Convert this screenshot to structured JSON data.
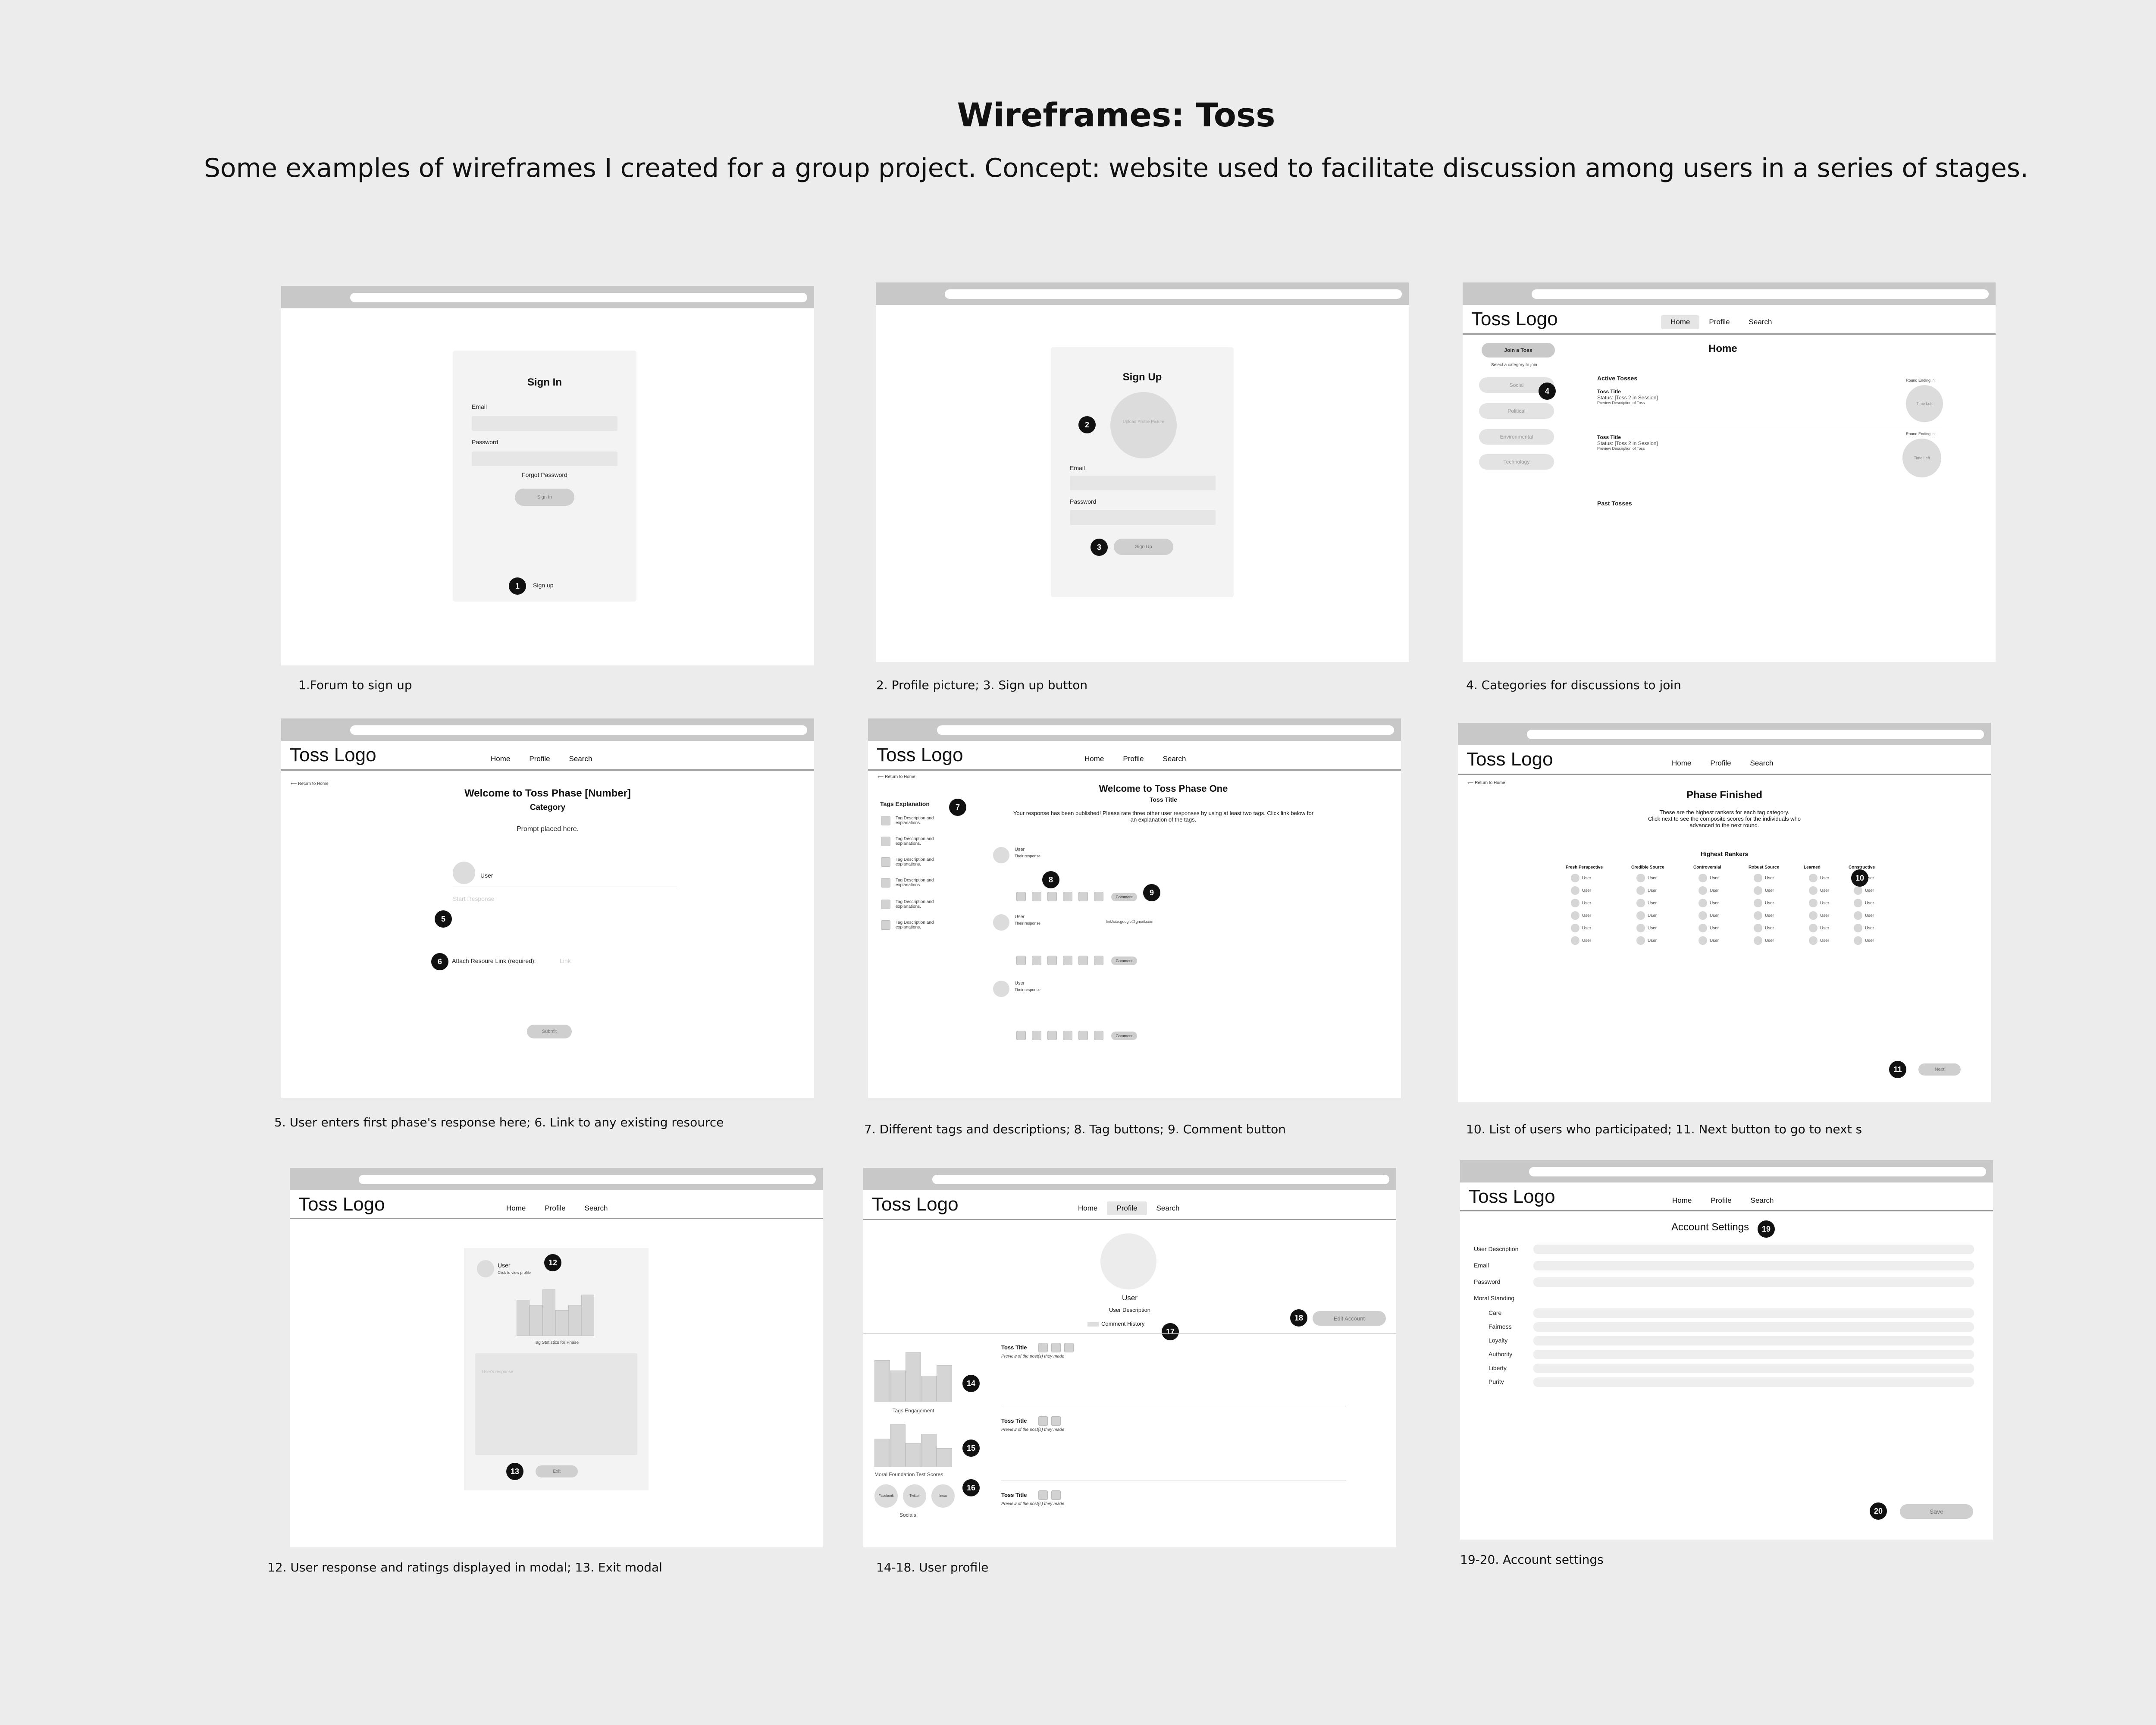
{
  "page": {
    "title": "Wireframes: Toss",
    "subtitle": "Some examples of wireframes I created for a group project. Concept: website used to facilitate discussion among users in a series of stages."
  },
  "common": {
    "logo": "Toss Logo",
    "nav": [
      "Home",
      "Profile",
      "Search"
    ],
    "return_home": "Return to Home"
  },
  "frame1": {
    "caption": "1.Forum to sign up",
    "heading": "Sign In",
    "email_label": "Email",
    "password_label": "Password",
    "forgot": "Forgot Password",
    "signin_btn": "Sign In",
    "signup_link": "Sign up",
    "marker": "1"
  },
  "frame2": {
    "caption": "2. Profile picture;  3. Sign up button",
    "heading": "Sign Up",
    "upload": "Upload Profile Picture",
    "email_label": "Email",
    "password_label": "Password",
    "signup_btn": "Sign Up",
    "markers": [
      "2",
      "3"
    ]
  },
  "frame3": {
    "caption": "4. Categories for discussions to join",
    "heading": "Home",
    "join_btn": "Join a Toss",
    "select_hint": "Select a category to join",
    "categories": [
      "Social",
      "Political",
      "Environmental",
      "Technology"
    ],
    "active": "Active Tosses",
    "past": "Past Tosses",
    "tosses": [
      {
        "title": "Toss Title",
        "status": "Status: [Toss 2 in Session]",
        "preview": "Preview Description of Toss",
        "round": "Round Ending in:",
        "timer": "Time Left"
      },
      {
        "title": "Toss Title",
        "status": "Status: [Toss 2 in Session]",
        "preview": "Preview Description of Toss",
        "round": "Round Ending in:",
        "timer": "Time Left"
      }
    ],
    "marker": "4"
  },
  "frame4": {
    "caption": "5. User enters first phase's response here; 6. Link to any existing resource",
    "heading": "Welcome to Toss Phase [Number]",
    "category": "Category",
    "prompt": "Prompt placed here.",
    "user": "User",
    "response_ph": "Start Response",
    "attach": "Attach Resoure Link (required):",
    "link_ph": "Link",
    "submit": "Submit",
    "markers": [
      "5",
      "6"
    ]
  },
  "frame5": {
    "caption": "7. Different tags and descriptions; 8. Tag buttons; 9. Comment button",
    "heading": "Welcome to Toss Phase One",
    "toss_title": "Toss Title",
    "notice": "Your response has been published! Please rate three other user responses by using at least two tags. Click link below for an explanation of the tags.",
    "tags_heading": "Tags Explanation",
    "tag_desc": [
      "Tag Description and explanations.",
      "Tag Description and explanations.",
      "Tag Description and explanations.",
      "Tag Description and explanations.",
      "Tag Description and explanations.",
      "Tag Description and explanations."
    ],
    "responses": [
      {
        "user": "User",
        "text": "Their response"
      },
      {
        "user": "User",
        "text": "Their response",
        "link": "link/site.google@gmail.com"
      },
      {
        "user": "User",
        "text": "Their response"
      }
    ],
    "comment": "Comment",
    "markers": [
      "7",
      "8",
      "9"
    ]
  },
  "frame6": {
    "caption": "10. List of users who participated; 11. Next button to go to next s",
    "heading": "Phase Finished",
    "desc": [
      "These are the highest rankers for each tag category.",
      "Click next to see the composite scores for the individuals who",
      "advanced to the next round."
    ],
    "rankers_heading": "Highest Rankers",
    "columns": [
      "Fresh Perspective",
      "Credible Source",
      "Controversial",
      "Robust Source",
      "Learned",
      "Constructive"
    ],
    "user": "User",
    "next": "Next",
    "markers": [
      "10",
      "11"
    ]
  },
  "frame7": {
    "caption": "12. User response and ratings displayed in modal; 13. Exit modal",
    "user": "User",
    "view_profile": "Click to view profile",
    "stats": "Tag Statistics for Phase",
    "response_ph": "User's response",
    "exit": "Exit",
    "chart_values": [
      70,
      60,
      90,
      50,
      60,
      80
    ],
    "markers": [
      "12",
      "13"
    ]
  },
  "frame8": {
    "caption": "14-18. User profile",
    "user": "User",
    "description": "User Description",
    "comment_history": "Comment History",
    "edit": "Edit Account",
    "posts": [
      {
        "title": "Toss Title",
        "preview": "Preview of the post(s) they made"
      },
      {
        "title": "Toss Title",
        "preview": "Preview of the post(s) they made"
      },
      {
        "title": "Toss Title",
        "preview": "Preview of the post(s) they made"
      }
    ],
    "tags_engagement": "Tags Engagement",
    "moral_scores": "Moral Foundation Test Scores",
    "socials": "Socials",
    "social_names": [
      "Facebook",
      "Twitter",
      "Insta"
    ],
    "chart1_values": [
      80,
      60,
      95,
      50,
      70
    ],
    "chart2_values": [
      60,
      90,
      50,
      70,
      40
    ],
    "markers": [
      "14",
      "15",
      "16",
      "17",
      "18"
    ]
  },
  "frame9": {
    "caption": "19-20. Account settings",
    "heading": "Account Settings",
    "fields": [
      "User Description",
      "Email",
      "Password"
    ],
    "moral": "Moral Standing",
    "moral_fields": [
      "Care",
      "Fairness",
      "Loyalty",
      "Authority",
      "Liberty",
      "Purity"
    ],
    "save": "Save",
    "markers": [
      "19",
      "20"
    ]
  },
  "colors": {
    "background": "#ececec",
    "marker": "#111111",
    "browser_bar": "#c8c8c8",
    "field": "#e6e6e6"
  }
}
